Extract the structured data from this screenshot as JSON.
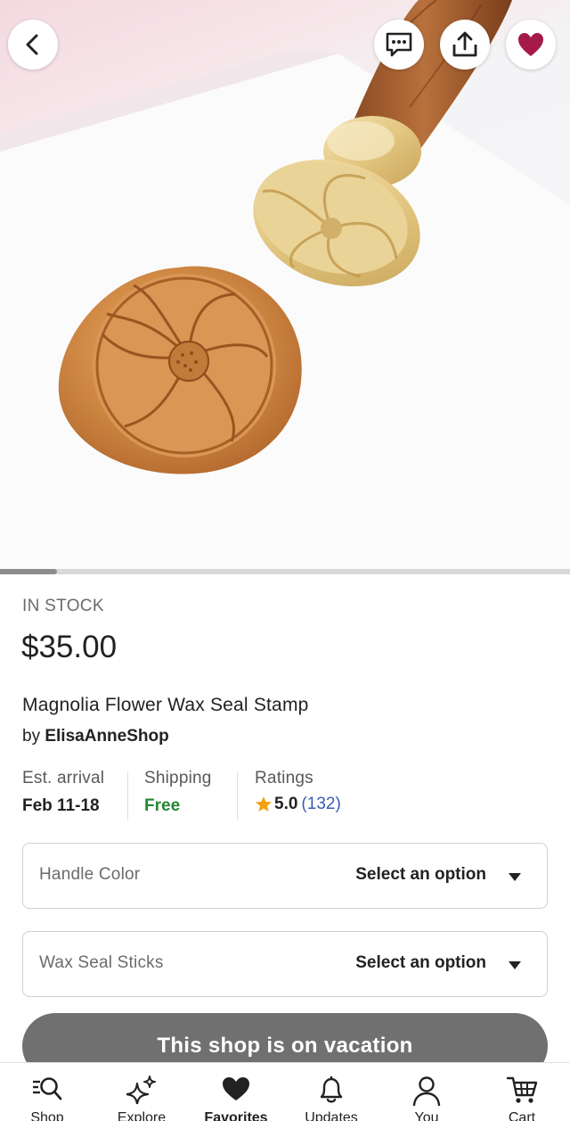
{
  "hero": {
    "image_alt": "Magnolia wax seal and brass stamp",
    "gallery_progress_fraction": 0.1,
    "is_favorited": true
  },
  "listing": {
    "stock_status": "IN STOCK",
    "price": "$35.00",
    "title": "Magnolia Flower Wax Seal Stamp",
    "by_prefix": "by",
    "shop_name": "ElisaAnneShop"
  },
  "facts": {
    "arrival_label": "Est. arrival",
    "arrival_value": "Feb 11-18",
    "shipping_label": "Shipping",
    "shipping_value": "Free",
    "ratings_label": "Ratings",
    "rating_score": "5.0",
    "rating_count": "(132)"
  },
  "options": [
    {
      "label": "Handle Color",
      "value": "Select an option"
    },
    {
      "label": "Wax Seal Sticks",
      "value": "Select an option"
    }
  ],
  "vacation_text": "This shop is on vacation",
  "tabs": [
    {
      "label": "Shop",
      "icon": "shop-search-icon"
    },
    {
      "label": "Explore",
      "icon": "sparkles-icon"
    },
    {
      "label": "Favorites",
      "icon": "heart-icon",
      "active": true
    },
    {
      "label": "Updates",
      "icon": "bell-icon"
    },
    {
      "label": "You",
      "icon": "person-icon"
    },
    {
      "label": "Cart",
      "icon": "cart-icon"
    }
  ],
  "colors": {
    "favorite_heart": "#a51a4a",
    "shipping_free": "#258635",
    "rating_count_link": "#3b5cb0",
    "star": "#f1a10d",
    "vacation_button": "#707070"
  }
}
